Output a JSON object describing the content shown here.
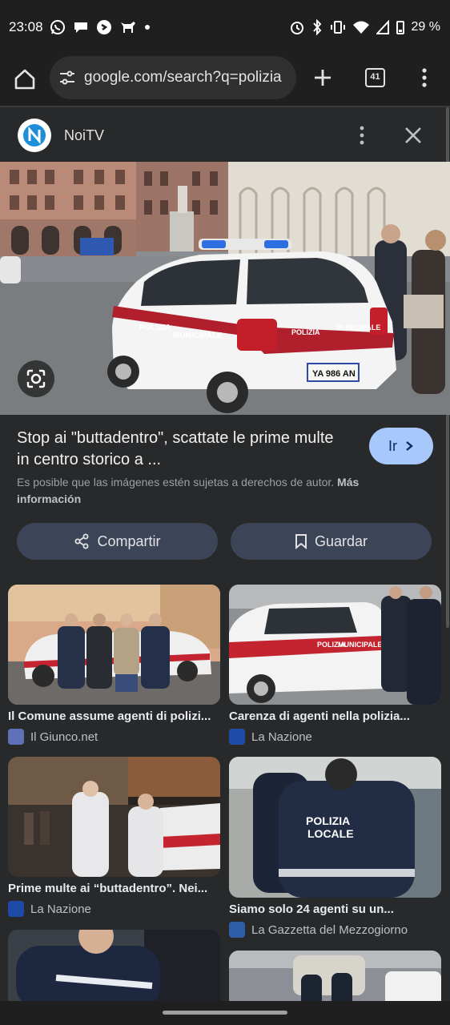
{
  "status": {
    "time": "23:08",
    "battery": "29 %"
  },
  "browser": {
    "url": "google.com/search?q=polizia",
    "tab_count": "41"
  },
  "source": {
    "name": "NoiTV"
  },
  "result": {
    "title": "Stop ai \"buttadentro\", scattate le prime multe in centro storico a ...",
    "go_label": "Ir",
    "copyright_text": "Es posible que las imágenes estén sujetas a derechos de autor.",
    "more_info": "Más información",
    "share_label": "Compartir",
    "save_label": "Guardar"
  },
  "main_image": {
    "car_text_1": "POLIZIA",
    "car_text_2": "MUNICIPALE",
    "plate": "YA 986 AN"
  },
  "related": [
    {
      "title": "Il Comune assume agenti di polizi...",
      "source": "Il Giunco.net",
      "fav_color": "#5f6fb8"
    },
    {
      "title": "Carenza di agenti nella polizia...",
      "source": "La Nazione",
      "fav_color": "#1f4ba8"
    },
    {
      "title": "Prime multe ai “buttadentro”. Nei...",
      "source": "La Nazione",
      "fav_color": "#1f4ba8"
    },
    {
      "title": "Siamo solo 24 agenti su un...",
      "source": "La Gazzetta del Mezzogiorno",
      "fav_color": "#2f5ea8"
    }
  ],
  "thumb_text": {
    "polizia": "POLIZIA",
    "locale": "LOCALE",
    "municipale": "MUNICIPALE"
  }
}
